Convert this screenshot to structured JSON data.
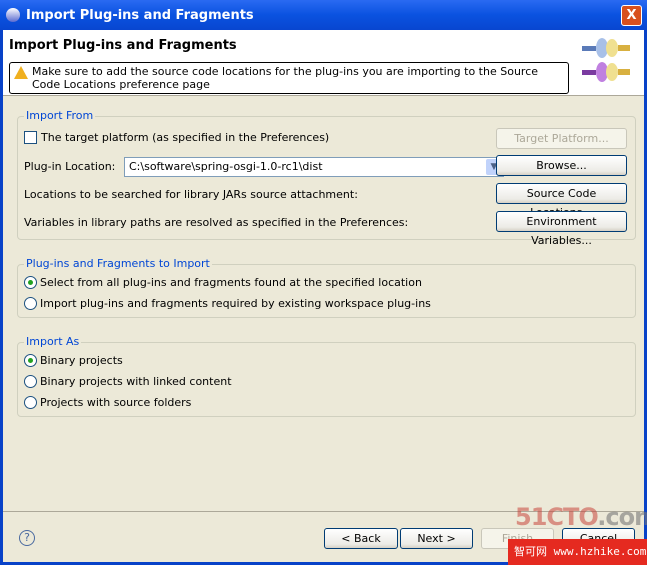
{
  "window": {
    "title": "Import Plug-ins and Fragments",
    "close": "X"
  },
  "header": {
    "title": "Import Plug-ins and Fragments",
    "message": "Make sure to add the source code locations for the plug-ins you are importing to the Source Code Locations preference page"
  },
  "import_from": {
    "label": "Import From",
    "target_platform_checkbox": "The target platform (as specified in the Preferences)",
    "target_platform_checked": false,
    "target_platform_button": "Target Platform...",
    "location_label": "Plug-in Location:",
    "location_value": "C:\\software\\spring-osgi-1.0-rc1\\dist",
    "browse_button": "Browse...",
    "source_label": "Locations to be searched for library JARs source attachment:",
    "source_button": "Source Code Locations...",
    "vars_label": "Variables in library paths are resolved as specified in the Preferences:",
    "vars_button": "Environment Variables..."
  },
  "to_import": {
    "label": "Plug-ins and Fragments to Import",
    "options": [
      "Select from all plug-ins and fragments found at the specified location",
      "Import plug-ins and fragments required by existing workspace plug-ins"
    ],
    "selected": 0
  },
  "import_as": {
    "label": "Import As",
    "options": [
      "Binary projects",
      "Binary projects with linked content",
      "Projects with source folders"
    ],
    "selected": 0
  },
  "footer": {
    "help": "?",
    "back": "< Back",
    "next": "Next >",
    "finish": "Finish",
    "cancel": "Cancel"
  },
  "watermarks": {
    "top": "51CTO",
    "top_suffix": ".com",
    "bottom": "智可网 www.hzhike.com"
  }
}
